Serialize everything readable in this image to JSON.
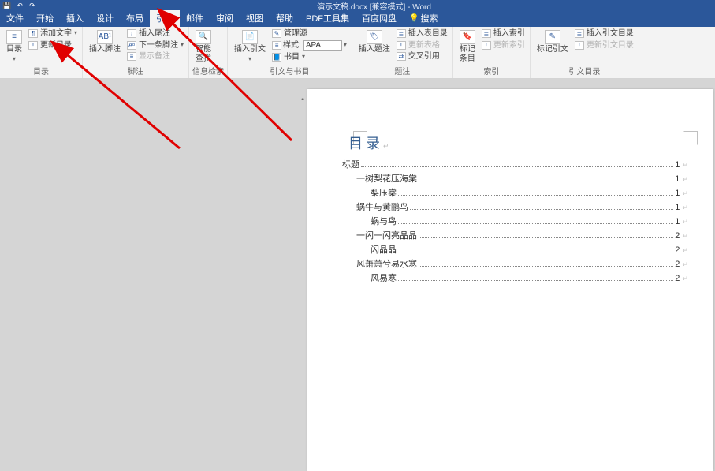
{
  "titlebar": {
    "doc_title": "演示文稿.docx [兼容模式] - Word"
  },
  "tabs": {
    "file": "文件",
    "home": "开始",
    "insert": "插入",
    "design": "设计",
    "layout": "布局",
    "references": "引用",
    "mailings": "邮件",
    "review": "审阅",
    "view": "视图",
    "help": "帮助",
    "pdf": "PDF工具集",
    "baidu": "百度网盘",
    "search": "搜索"
  },
  "ribbon": {
    "toc": {
      "toc_btn": "目录",
      "add_text": "添加文字",
      "update": "更新目录",
      "group": "目录"
    },
    "footnotes": {
      "insert_fn": "插入脚注",
      "insert_en": "插入尾注",
      "next_fn": "下一条脚注",
      "show": "显示备注",
      "group": "脚注"
    },
    "research": {
      "smart_lookup": "智能\n查找",
      "group": "信息检索"
    },
    "citations": {
      "insert_cite": "插入引文",
      "manage": "管理源",
      "style_label": "样式:",
      "style_value": "APA",
      "biblio": "书目",
      "group": "引文与书目"
    },
    "captions": {
      "insert_caption": "插入题注",
      "insert_tof": "插入表目录",
      "update_table": "更新表格",
      "cross_ref": "交叉引用",
      "group": "题注"
    },
    "index": {
      "mark_entry": "标记\n条目",
      "insert_index": "插入索引",
      "update_index": "更新索引",
      "group": "索引"
    },
    "toa": {
      "mark_cite": "标记引文",
      "insert_toa": "插入引文目录",
      "update_toa": "更新引文目录",
      "group": "引文目录"
    }
  },
  "document": {
    "toc_heading": "目录",
    "entries": [
      {
        "level": 1,
        "text": "标题",
        "page": "1"
      },
      {
        "level": 2,
        "text": "一树梨花压海棠",
        "page": "1"
      },
      {
        "level": 3,
        "text": "梨压棠",
        "page": "1"
      },
      {
        "level": 2,
        "text": "蜗牛与黄鹂鸟",
        "page": "1"
      },
      {
        "level": 3,
        "text": "蜗与鸟",
        "page": "1"
      },
      {
        "level": 2,
        "text": "一闪一闪亮晶晶",
        "page": "2"
      },
      {
        "level": 3,
        "text": "闪晶晶",
        "page": "2"
      },
      {
        "level": 2,
        "text": "风萧萧兮易水寒",
        "page": "2"
      },
      {
        "level": 3,
        "text": "风易寒",
        "page": "2"
      }
    ]
  }
}
